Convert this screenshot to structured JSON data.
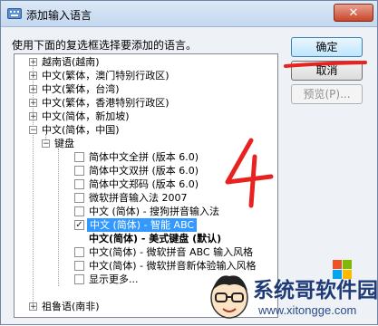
{
  "window": {
    "title": "添加输入语言",
    "close_glyph": "✕"
  },
  "instruction": "使用下面的复选框选择要添加的语言。",
  "buttons": {
    "ok": "确定",
    "cancel": "取消",
    "preview": "预览(P)..."
  },
  "tree": [
    {
      "label": "越南语(越南)",
      "expander": "+"
    },
    {
      "label": "中文(繁体，澳门特别行政区)",
      "expander": "+"
    },
    {
      "label": "中文(繁体，台湾)",
      "expander": "+"
    },
    {
      "label": "中文(繁体，香港特别行政区)",
      "expander": "+"
    },
    {
      "label": "中文(简体，新加坡)",
      "expander": "+"
    },
    {
      "label": "中文(简体，中国)",
      "expander": "−"
    },
    {
      "label": "键盘",
      "expander": "−"
    },
    {
      "label": "简体中文全拼 (版本 6.0)",
      "checked": false
    },
    {
      "label": "简体中文双拼 (版本 6.0)",
      "checked": false
    },
    {
      "label": "简体中文郑码 (版本 6.0)",
      "checked": false
    },
    {
      "label": "微软拼音输入法 2007",
      "checked": false
    },
    {
      "label": "中文 (简体) - 搜狗拼音输入法",
      "checked": false
    },
    {
      "label": "中文 (简体) - 智能 ABC",
      "checked": true,
      "selected": true
    },
    {
      "label": "中文(简体) - 美式键盘 (默认)",
      "bold": true
    },
    {
      "label": "中文(简体) - 微软拼音 ABC 输入风格",
      "checked": false
    },
    {
      "label": "中文(简体) - 微软拼音新体验输入风格",
      "checked": false
    },
    {
      "label": "显示更多...",
      "checked": false
    },
    {
      "label": "祖鲁语(南非)",
      "expander": "+"
    }
  ],
  "annotation": {
    "text": "4",
    "color": "#e8221f"
  },
  "watermark": {
    "title": "系统哥软件园",
    "url": "www.xitongge.com"
  }
}
